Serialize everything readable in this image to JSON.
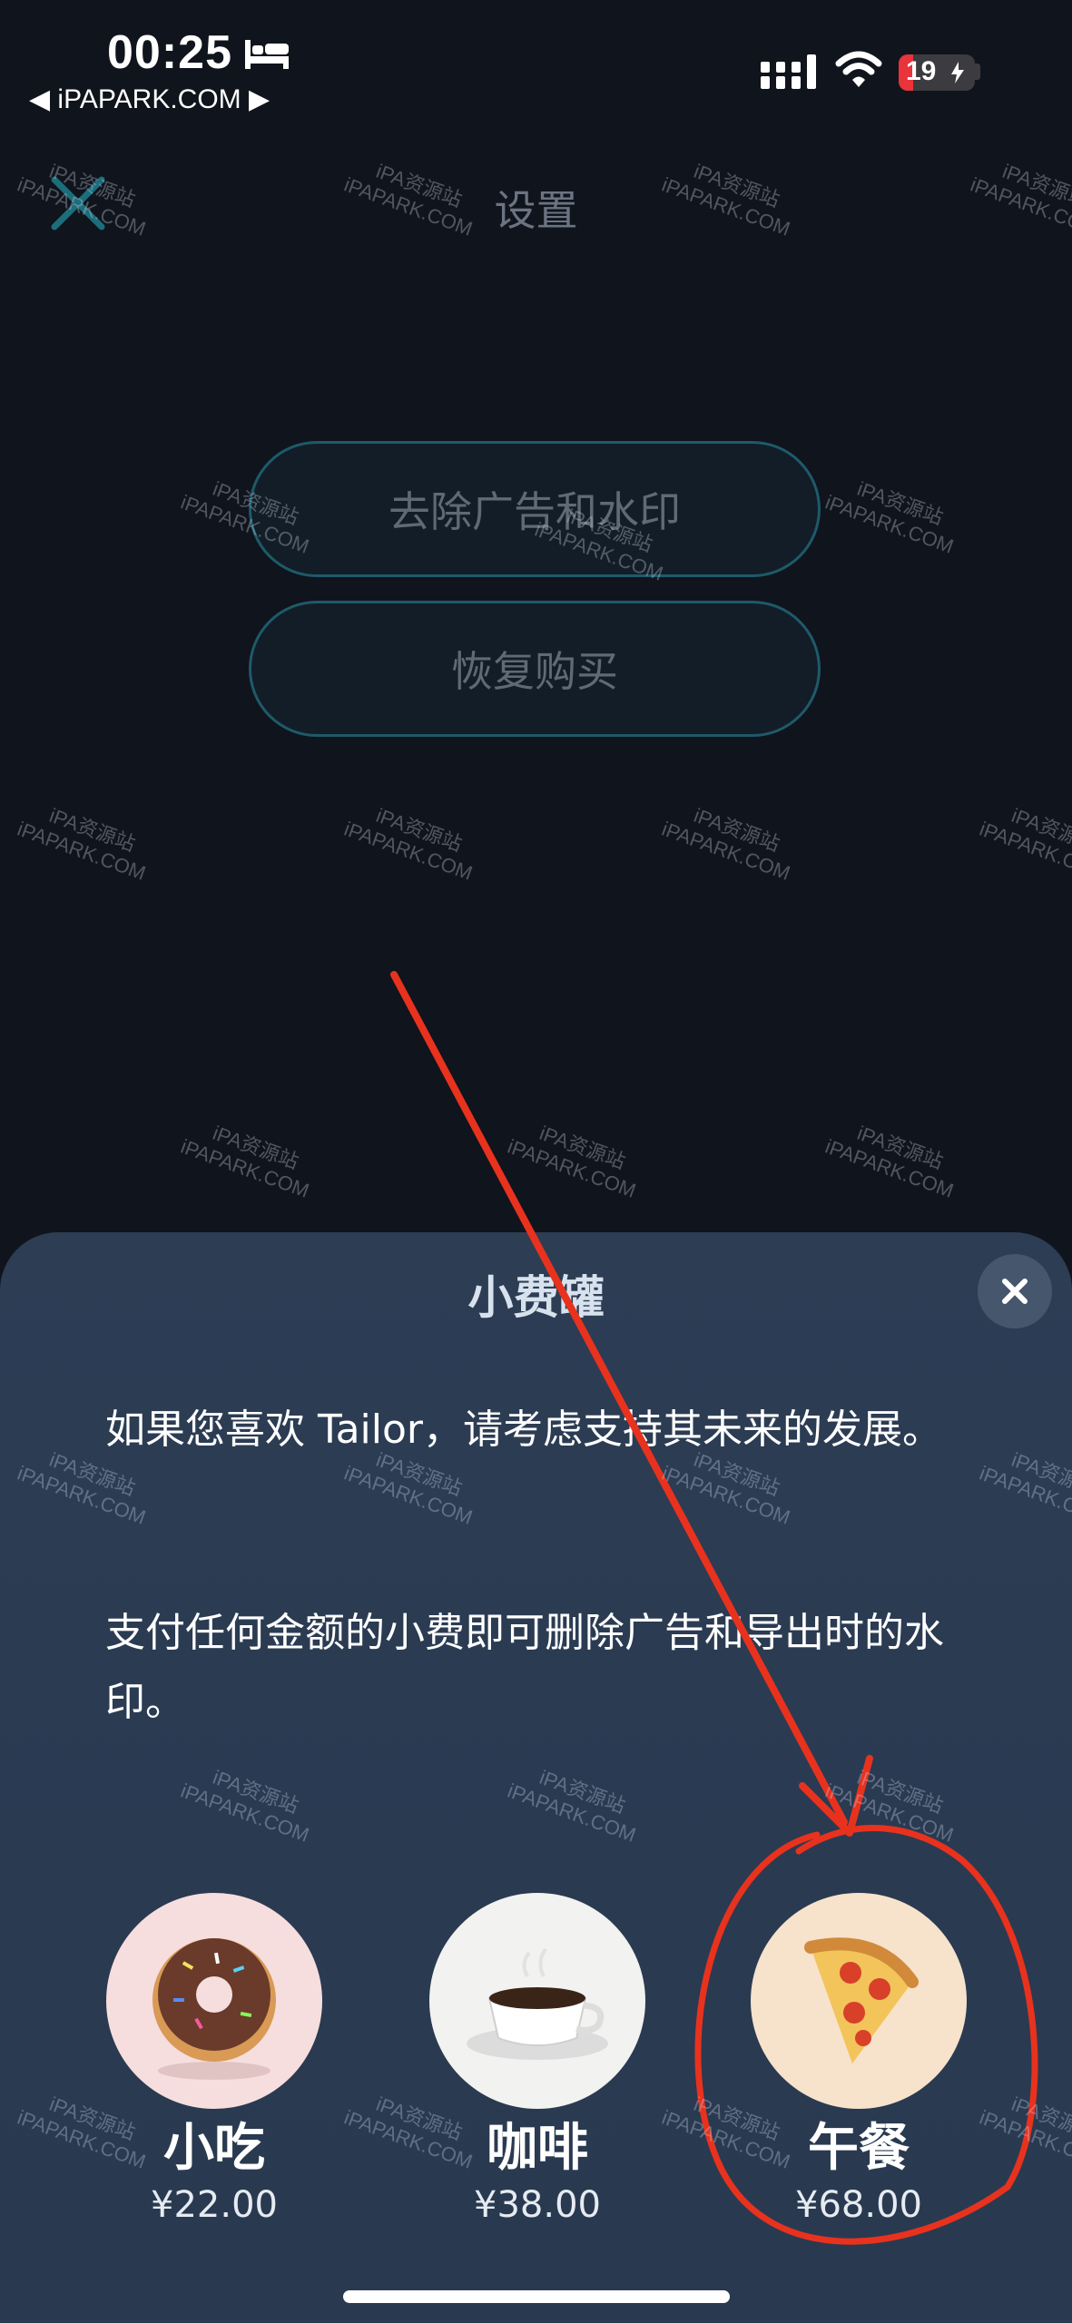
{
  "status_bar": {
    "time": "00:25",
    "back_app": "◀ iPAPARK.COM ▶",
    "battery": "19",
    "battery_percent": 19
  },
  "main": {
    "title": "设置",
    "remove_ads_button": "去除广告和水印",
    "restore_button": "恢复购买"
  },
  "tip_jar": {
    "title": "小费罐",
    "paragraph1": "如果您喜欢 Tailor，请考虑支持其未来的发展。",
    "paragraph2": "支付任何金额的小费即可删除广告和导出时的水印。",
    "items": [
      {
        "name": "小吃",
        "price": "¥22.00",
        "icon": "donut-icon"
      },
      {
        "name": "咖啡",
        "price": "¥38.00",
        "icon": "coffee-icon"
      },
      {
        "name": "午餐",
        "price": "¥68.00",
        "icon": "pizza-icon"
      }
    ]
  },
  "watermark": {
    "line1": "iPA资源站",
    "line2": "iPAPARK.COM"
  },
  "colors": {
    "background": "#10141c",
    "sheet": "#2d3d54",
    "button_border": "#1e5a6a",
    "annotation_red": "#e8321e"
  }
}
